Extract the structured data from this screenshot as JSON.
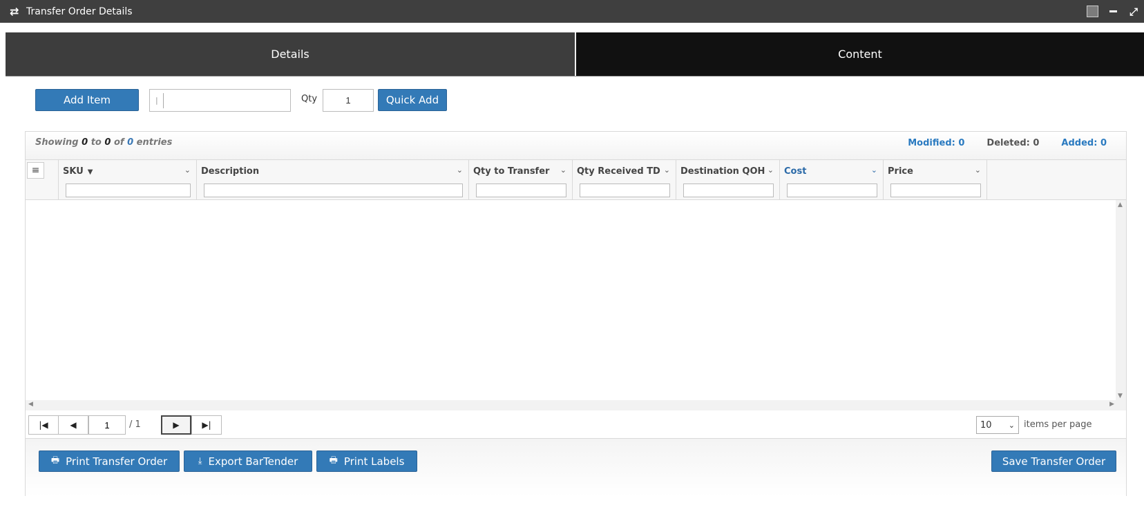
{
  "window": {
    "title": "Transfer Order Details",
    "icon": "swap-arrows-icon"
  },
  "tabs": [
    {
      "label": "Details",
      "active": false
    },
    {
      "label": "Content",
      "active": true
    }
  ],
  "add_bar": {
    "add_item_label": "Add Item",
    "barcode_value": "",
    "qty_label": "Qty",
    "qty_value": "1",
    "quick_add_label": "Quick Add"
  },
  "grid": {
    "showing": {
      "prefix": "Showing",
      "from": "0",
      "to_word": "to",
      "to": "0",
      "of_word": "of",
      "total": "0",
      "suffix": "entries"
    },
    "counts": {
      "modified": "Modified: 0",
      "deleted": "Deleted: 0",
      "added": "Added: 0"
    },
    "columns": [
      {
        "label": "SKU",
        "sorted": true
      },
      {
        "label": "Description"
      },
      {
        "label": "Qty to Transfer"
      },
      {
        "label": "Qty Received TD"
      },
      {
        "label": "Destination QOH"
      },
      {
        "label": "Cost",
        "highlight": true
      },
      {
        "label": "Price"
      }
    ],
    "rows": []
  },
  "pager": {
    "page": "1",
    "total_pages": "/ 1",
    "per_page": "10",
    "per_page_label": "items per page"
  },
  "footer": {
    "print_transfer_order": "Print Transfer Order",
    "export_bartender": "Export BarTender",
    "print_labels": "Print Labels",
    "save_transfer_order": "Save Transfer Order"
  },
  "colors": {
    "accent": "#337ab7",
    "titlebar": "#3f3f3f",
    "tab_active": "#111111",
    "tab_inactive": "#3d3d3d",
    "count_blue": "#2a7ac0"
  }
}
